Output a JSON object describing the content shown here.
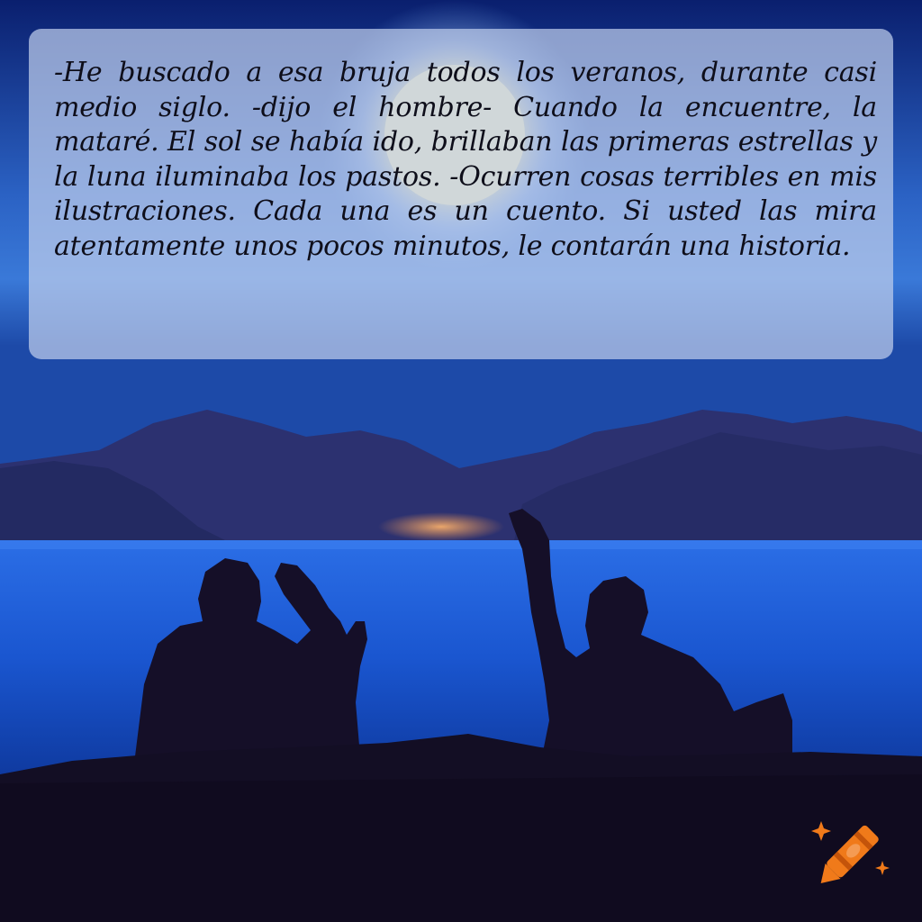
{
  "caption": {
    "text": "-He buscado a esa bruja todos los veranos, durante casi medio siglo. -dijo el hombre- Cuando la encuentre, la mataré. El sol se había ido, brillaban las primeras estrellas y la luna iluminaba los pastos. -Ocurren cosas terribles en mis ilustraciones. Cada una es un cuento. Si usted las mira atentamente unos pocos minutos, le contarán una historia."
  },
  "scene": {
    "sky_top_color": "#0b2a85",
    "sky_mid_color": "#2f6fd0",
    "moon_color": "#fff3b0",
    "mountain_color": "#2a2f6b",
    "water_color": "#1e5fe0",
    "silhouette_color": "#140f26"
  },
  "logo": {
    "icon": "crayon-sparkle-icon",
    "color": "#f07a1a"
  }
}
